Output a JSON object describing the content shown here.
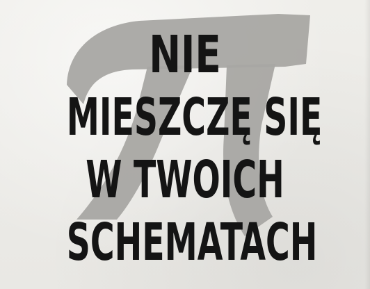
{
  "shirt": {
    "background_color": "#ecebe7",
    "text_color": "#141414",
    "symbol_color": "#a8a6a3",
    "symbol_icon": "pi-icon"
  },
  "slogan": {
    "lines": [
      "NIE",
      "MIESZCZĘ SIĘ",
      "W TWOICH",
      "SCHEMATACH"
    ]
  }
}
